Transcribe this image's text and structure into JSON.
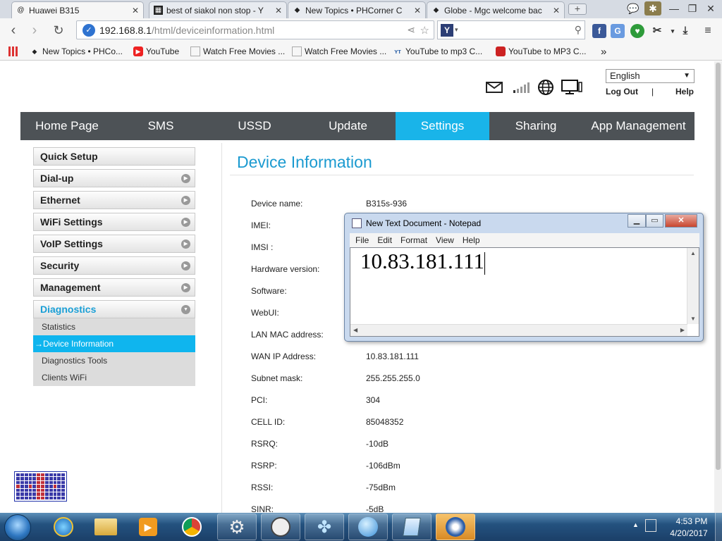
{
  "browser": {
    "tabs": [
      {
        "title": "Huawei B315",
        "icon": "at-icon",
        "active": true
      },
      {
        "title": "best of siakol non stop - Y",
        "icon": "film-icon"
      },
      {
        "title": "New Topics • PHCorner C",
        "icon": "phcorner-icon"
      },
      {
        "title": "Globe - Mgc welcome bac",
        "icon": "globe-icon"
      }
    ],
    "address": {
      "host": "192.168.8.1",
      "path": "/html/deviceinformation.html"
    },
    "bookmarks": [
      {
        "label": "New Topics • PHCo...",
        "icon": "phcorner-icon"
      },
      {
        "label": "YouTube",
        "icon": "youtube-icon"
      },
      {
        "label": "Watch Free Movies ...",
        "icon": "page-icon"
      },
      {
        "label": "Watch Free Movies ...",
        "icon": "page-icon"
      },
      {
        "label": "YouTube to mp3 C...",
        "icon": "mp3-icon"
      },
      {
        "label": "YouTube to MP3 C...",
        "icon": "converter-icon"
      }
    ],
    "bookmarks_overflow": "»"
  },
  "router": {
    "language": "English",
    "logout": "Log Out",
    "separator": "|",
    "help": "Help",
    "nav": [
      "Home Page",
      "SMS",
      "USSD",
      "Update",
      "Settings",
      "Sharing",
      "App Management"
    ],
    "active_nav": "Settings",
    "sidebar": [
      {
        "label": "Quick Setup"
      },
      {
        "label": "Dial-up"
      },
      {
        "label": "Ethernet"
      },
      {
        "label": "WiFi Settings"
      },
      {
        "label": "VoIP Settings"
      },
      {
        "label": "Security"
      },
      {
        "label": "Management"
      },
      {
        "label": "Diagnostics"
      }
    ],
    "diagnostics_sub": [
      {
        "label": "Statistics"
      },
      {
        "label": "Device Information",
        "arrow": "→"
      },
      {
        "label": "Diagnostics Tools"
      },
      {
        "label": "Clients WiFi"
      }
    ],
    "page_title": "Device Information",
    "info": [
      {
        "label": "Device name:",
        "value": "B315s-936"
      },
      {
        "label": "IMEI:",
        "value": ""
      },
      {
        "label": "IMSI :",
        "value": ""
      },
      {
        "label": "Hardware version:",
        "value": ""
      },
      {
        "label": "Software:",
        "value": ""
      },
      {
        "label": "WebUI:",
        "value": ""
      },
      {
        "label": "LAN MAC address:",
        "value": ""
      },
      {
        "label": "WAN IP Address:",
        "value": "10.83.181.111"
      },
      {
        "label": "Subnet mask:",
        "value": "255.255.255.0"
      },
      {
        "label": "PCI:",
        "value": "304"
      },
      {
        "label": "CELL ID:",
        "value": "85048352"
      },
      {
        "label": "RSRQ:",
        "value": "-10dB"
      },
      {
        "label": "RSRP:",
        "value": "-106dBm"
      },
      {
        "label": "RSSI:",
        "value": "-75dBm"
      },
      {
        "label": "SINR:",
        "value": "-5dB"
      }
    ]
  },
  "notepad": {
    "title": "New Text Document - Notepad",
    "menu": [
      "File",
      "Edit",
      "Format",
      "View",
      "Help"
    ],
    "content": "10.83.181.111"
  },
  "taskbar": {
    "apps": [
      "internet-explorer-icon",
      "file-explorer-icon",
      "media-player-icon",
      "chrome-icon",
      "settings-gear-icon",
      "clock-app-icon",
      "fan-app-icon",
      "sphere-app-icon",
      "notepad-icon",
      "huawei-mobile-icon"
    ],
    "time": "4:53 PM",
    "date": "4/20/2017"
  },
  "colors": {
    "accent": "#19b4e9",
    "nav_bg": "#4d5256",
    "title_blue": "#1b9ad0"
  }
}
